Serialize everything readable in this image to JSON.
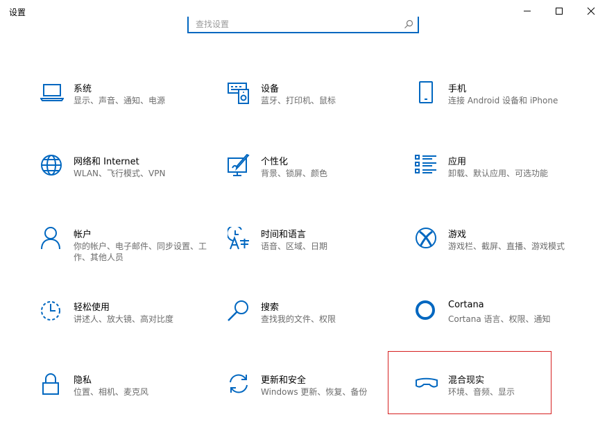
{
  "window": {
    "title": "设置"
  },
  "search": {
    "placeholder": "查找设置"
  },
  "accent_color": "#0067c0",
  "tiles": [
    {
      "name": "系统",
      "desc": "显示、声音、通知、电源",
      "icon": "laptop-icon"
    },
    {
      "name": "设备",
      "desc": "蓝牙、打印机、鼠标",
      "icon": "devices-icon"
    },
    {
      "name": "手机",
      "desc": "连接 Android 设备和 iPhone",
      "icon": "phone-icon"
    },
    {
      "name": "网络和 Internet",
      "desc": "WLAN、飞行模式、VPN",
      "icon": "globe-icon"
    },
    {
      "name": "个性化",
      "desc": "背景、锁屏、颜色",
      "icon": "personalization-icon"
    },
    {
      "name": "应用",
      "desc": "卸载、默认应用、可选功能",
      "icon": "apps-list-icon"
    },
    {
      "name": "帐户",
      "desc": "你的帐户、电子邮件、同步设置、工作、其他人员",
      "icon": "person-icon"
    },
    {
      "name": "时间和语言",
      "desc": "语音、区域、日期",
      "icon": "time-language-icon"
    },
    {
      "name": "游戏",
      "desc": "游戏栏、截屏、直播、游戏模式",
      "icon": "xbox-icon"
    },
    {
      "name": "轻松使用",
      "desc": "讲述人、放大镜、高对比度",
      "icon": "ease-of-access-icon"
    },
    {
      "name": "搜索",
      "desc": "查找我的文件、权限",
      "icon": "search-icon"
    },
    {
      "name": "Cortana",
      "desc": "Cortana 语言、权限、通知",
      "icon": "cortana-icon"
    },
    {
      "name": "隐私",
      "desc": "位置、相机、麦克风",
      "icon": "lock-icon"
    },
    {
      "name": "更新和安全",
      "desc": "Windows 更新、恢复、备份",
      "icon": "sync-icon"
    },
    {
      "name": "混合现实",
      "desc": "环境、音频、显示",
      "icon": "headset-icon"
    }
  ]
}
